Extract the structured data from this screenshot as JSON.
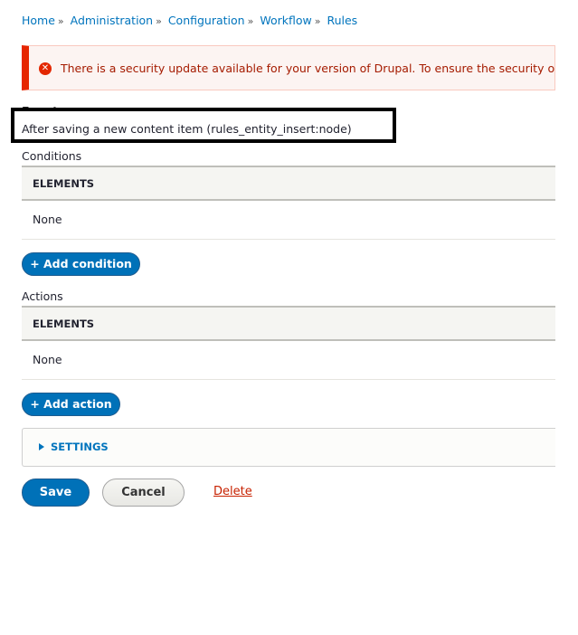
{
  "breadcrumb": {
    "items": [
      "Home",
      "Administration",
      "Configuration",
      "Workflow",
      "Rules"
    ],
    "separator": "»"
  },
  "message": {
    "type": "error",
    "icon": "error-x-icon",
    "text": "There is a security update available for your version of Drupal. To ensure the security of your server, you should update immediately!"
  },
  "events": {
    "label": "Events:",
    "value": "After saving a new content item (rules_entity_insert:node)"
  },
  "conditions": {
    "label": "Conditions",
    "column_header": "ELEMENTS",
    "rows": [
      "None"
    ],
    "add_button": "+ Add condition"
  },
  "actions": {
    "label": "Actions",
    "column_header": "ELEMENTS",
    "rows": [
      "None"
    ],
    "add_button": "+ Add action"
  },
  "settings": {
    "summary": "SETTINGS",
    "expanded": false
  },
  "form_actions": {
    "save": "Save",
    "cancel": "Cancel",
    "delete": "Delete"
  }
}
